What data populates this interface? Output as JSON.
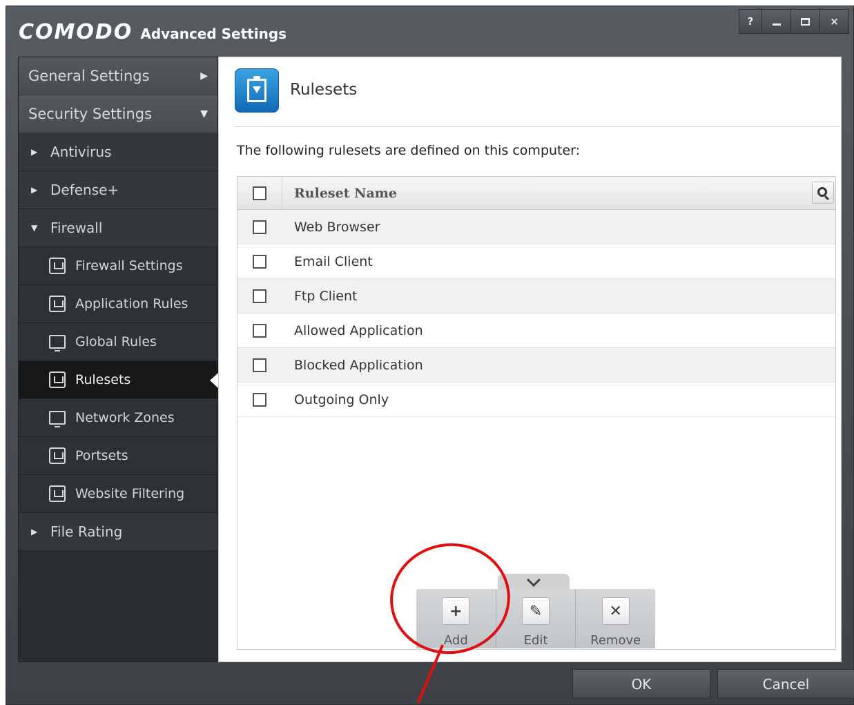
{
  "window": {
    "brand": "COMODO",
    "title": "Advanced Settings",
    "controls": [
      "?",
      "_",
      "□",
      "×"
    ]
  },
  "sidebar": {
    "top": [
      {
        "label": "General Settings",
        "arrow": "▶"
      },
      {
        "label": "Security Settings",
        "arrow": "▼"
      }
    ],
    "sections": [
      {
        "label": "Antivirus",
        "tri": "▶"
      },
      {
        "label": "Defense+",
        "tri": "▶"
      },
      {
        "label": "Firewall",
        "tri": "▼"
      }
    ],
    "firewall_items": [
      {
        "label": "Firewall Settings",
        "icon": "firewall-settings-icon"
      },
      {
        "label": "Application Rules",
        "icon": "application-rules-icon"
      },
      {
        "label": "Global Rules",
        "icon": "global-rules-icon"
      },
      {
        "label": "Rulesets",
        "icon": "rulesets-icon",
        "active": true
      },
      {
        "label": "Network Zones",
        "icon": "network-zones-icon"
      },
      {
        "label": "Portsets",
        "icon": "portsets-icon"
      },
      {
        "label": "Website Filtering",
        "icon": "website-filtering-icon"
      }
    ],
    "after": {
      "label": "File Rating",
      "tri": "▶"
    }
  },
  "content": {
    "title": "Rulesets",
    "intro": "The following rulesets are defined on this computer:",
    "table": {
      "header": "Ruleset Name",
      "rows": [
        "Web Browser",
        "Email Client",
        "Ftp Client",
        "Allowed Application",
        "Blocked Application",
        "Outgoing Only"
      ]
    },
    "toolbar": {
      "add": "Add",
      "edit": "Edit",
      "remove": "Remove"
    }
  },
  "footer": {
    "ok": "OK",
    "cancel": "Cancel"
  },
  "colors": {
    "annotation": "#e01010",
    "header_icon": "#1a7fcf"
  }
}
